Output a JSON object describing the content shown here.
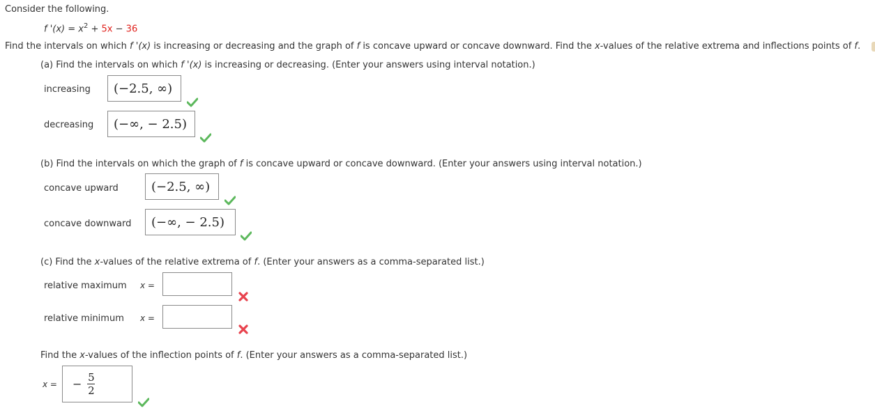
{
  "intro": "Consider the following.",
  "function": {
    "lhs": "f '(x) = x",
    "exponent": "2",
    "plus": " + ",
    "linear_term": "5x",
    "minus": " − ",
    "constant": "36"
  },
  "instructions": {
    "part1": "Find the intervals on which ",
    "fprime": "f '(x)",
    "part2": " is increasing or decreasing and the graph of ",
    "f1": "f",
    "part3": " is concave upward or concave downward. Find the ",
    "x1": "x",
    "part4": "-values of the relative extrema and inflections points of ",
    "f2": "f",
    "part5": "."
  },
  "part_a": {
    "prompt_1": "(a) Find the intervals on which ",
    "fprime": "f '(x)",
    "prompt_2": " is increasing or decreasing. (Enter your answers using interval notation.)",
    "increasing_label": "increasing",
    "increasing_value": "(−2.5, ∞)",
    "increasing_status": "correct",
    "decreasing_label": "decreasing",
    "decreasing_value": "(−∞, − 2.5)",
    "decreasing_status": "correct"
  },
  "part_b": {
    "prompt_1": "(b) Find the intervals on which the graph of ",
    "f": "f",
    "prompt_2": " is concave upward or concave downward. (Enter your answers using interval notation.)",
    "concave_up_label": "concave upward",
    "concave_up_value": "(−2.5, ∞)",
    "concave_up_status": "correct",
    "concave_down_label": "concave downward",
    "concave_down_value": "(−∞,  − 2.5)",
    "concave_down_status": "correct"
  },
  "part_c": {
    "prompt_1": "(c) Find the ",
    "x": "x",
    "prompt_2": "-values of the relative extrema of ",
    "f": "f",
    "prompt_3": ". (Enter your answers as a comma-separated list.)",
    "rel_max_label": "relative maximum",
    "rel_max_x": "x",
    "rel_max_eq": " =",
    "rel_max_value": "",
    "rel_max_status": "incorrect",
    "rel_min_label": "relative minimum",
    "rel_min_x": "x",
    "rel_min_eq": " =",
    "rel_min_value": "",
    "rel_min_status": "incorrect"
  },
  "inflection": {
    "prompt_1": "Find the ",
    "x": "x",
    "prompt_2": "-values of the inflection points of ",
    "f": "f",
    "prompt_3": ". (Enter your answers as a comma-separated list.)",
    "x_label": "x",
    "eq": " =",
    "sign": "−",
    "numerator": "5",
    "denominator": "2",
    "status": "correct"
  },
  "colors": {
    "correct": "#5cb85c",
    "incorrect": "#e8424d",
    "highlight": "#e0201b"
  }
}
